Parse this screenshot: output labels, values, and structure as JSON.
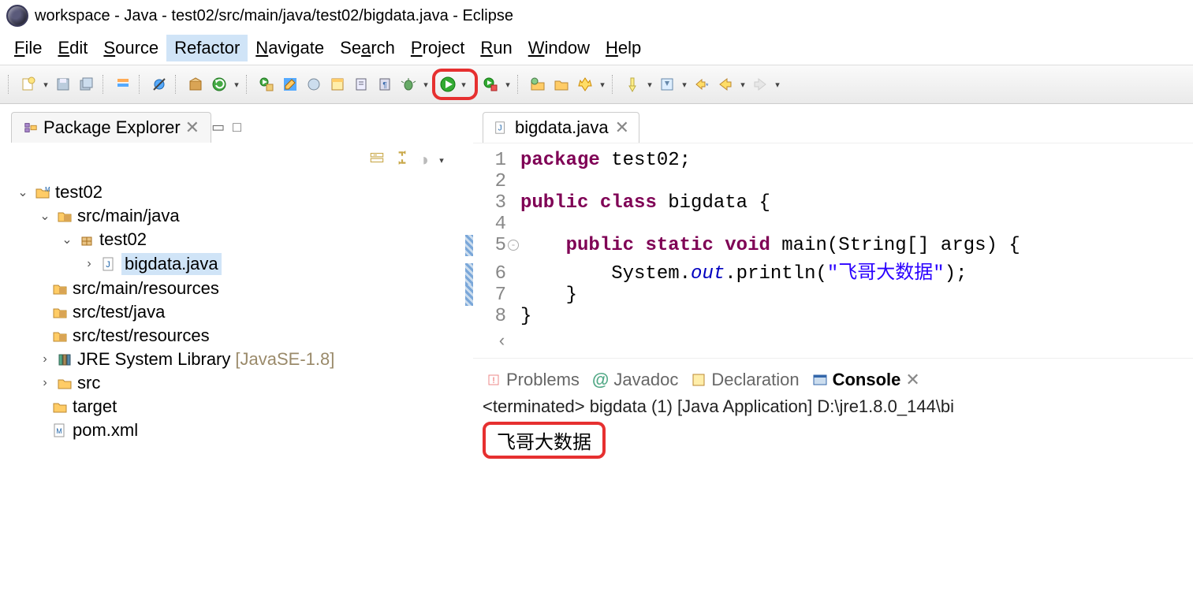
{
  "window": {
    "title": "workspace - Java - test02/src/main/java/test02/bigdata.java - Eclipse"
  },
  "menubar": [
    {
      "label": "File",
      "u": "F"
    },
    {
      "label": "Edit",
      "u": "E"
    },
    {
      "label": "Source",
      "u": "S"
    },
    {
      "label": "Refactor",
      "u": "",
      "selected": true
    },
    {
      "label": "Navigate",
      "u": "N"
    },
    {
      "label": "Search",
      "u": "S"
    },
    {
      "label": "Project",
      "u": "P"
    },
    {
      "label": "Run",
      "u": "R"
    },
    {
      "label": "Window",
      "u": "W"
    },
    {
      "label": "Help",
      "u": "H"
    }
  ],
  "explorer": {
    "title": "Package Explorer",
    "tree": {
      "project": "test02",
      "src_main_java": "src/main/java",
      "pkg": "test02",
      "file": "bigdata.java",
      "src_main_resources": "src/main/resources",
      "src_test_java": "src/test/java",
      "src_test_resources": "src/test/resources",
      "jre": "JRE System Library",
      "jre_tag": "[JavaSE-1.8]",
      "src": "src",
      "target": "target",
      "pom": "pom.xml"
    }
  },
  "editor": {
    "tab": "bigdata.java",
    "lines": {
      "l1a": "package",
      "l1b": " test02;",
      "l3a": "public",
      "l3b": "class",
      "l3c": " bigdata {",
      "l5a": "public",
      "l5b": "static",
      "l5c": "void",
      "l5d": " main(String[] args) {",
      "l6a": "        System.",
      "l6b": "out",
      "l6c": ".println(",
      "l6d": "\"飞哥大数据\"",
      "l6e": ");",
      "l7": "    }",
      "l8": "}"
    },
    "nums": {
      "n1": "1",
      "n2": "2",
      "n3": "3",
      "n4": "4",
      "n5": "5",
      "n6": "6",
      "n7": "7",
      "n8": "8"
    }
  },
  "bottom": {
    "problems": "Problems",
    "javadoc": "Javadoc",
    "declaration": "Declaration",
    "console": "Console",
    "status": "<terminated> bigdata (1) [Java Application] D:\\jre1.8.0_144\\bi",
    "output": "飞哥大数据"
  }
}
